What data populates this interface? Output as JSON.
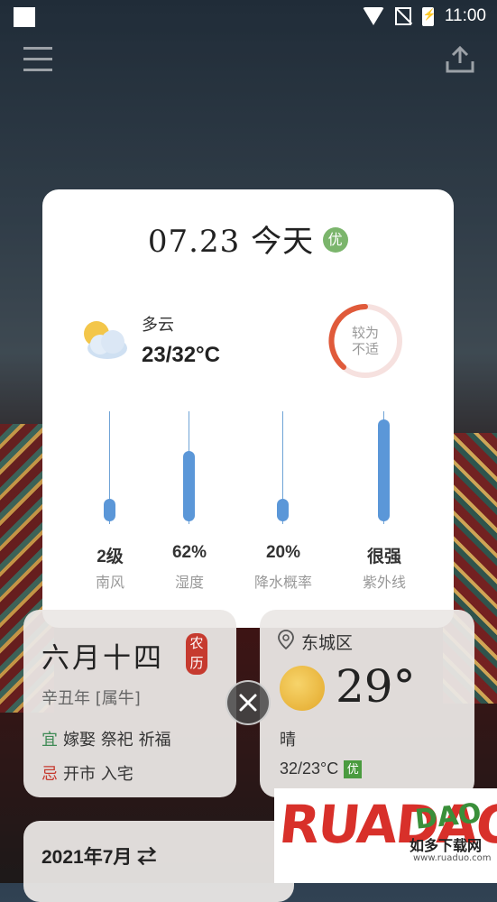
{
  "status_bar": {
    "time": "11:00"
  },
  "popup": {
    "date_title": "07.23 今天",
    "air_quality": "优",
    "condition": "多云",
    "temp_range": "23/32°C",
    "comfort_line1": "较为",
    "comfort_line2": "不适",
    "stats": [
      {
        "value": "2级",
        "label": "南风",
        "level": 0.2
      },
      {
        "value": "62%",
        "label": "湿度",
        "level": 0.62
      },
      {
        "value": "20%",
        "label": "降水概率",
        "level": 0.2
      },
      {
        "value": "很强",
        "label": "紫外线",
        "level": 0.9
      }
    ]
  },
  "lunar_card": {
    "date": "六月十四",
    "seal_top": "农",
    "seal_bottom": "历",
    "year": "辛丑年 [属牛]",
    "yi_tag": "宜",
    "yi_text": "嫁娶 祭祀 祈福",
    "ji_tag": "忌",
    "ji_text": "开市 入宅"
  },
  "weather_card": {
    "location": "东城区",
    "temperature": "29°",
    "condition": "晴",
    "range": "32/23°C",
    "air_quality": "优"
  },
  "month_card": {
    "label": "2021年7月 ⇄"
  },
  "watermark": {
    "brand": "RUADAO",
    "brand_small": "DAO",
    "cn": "如多下载网",
    "url": "www.ruaduo.com"
  },
  "colors": {
    "accent_blue": "#5b97d8",
    "quality_green": "#7bb56c",
    "comfort_red": "#e05a3a",
    "seal_red": "#c63a2f"
  }
}
